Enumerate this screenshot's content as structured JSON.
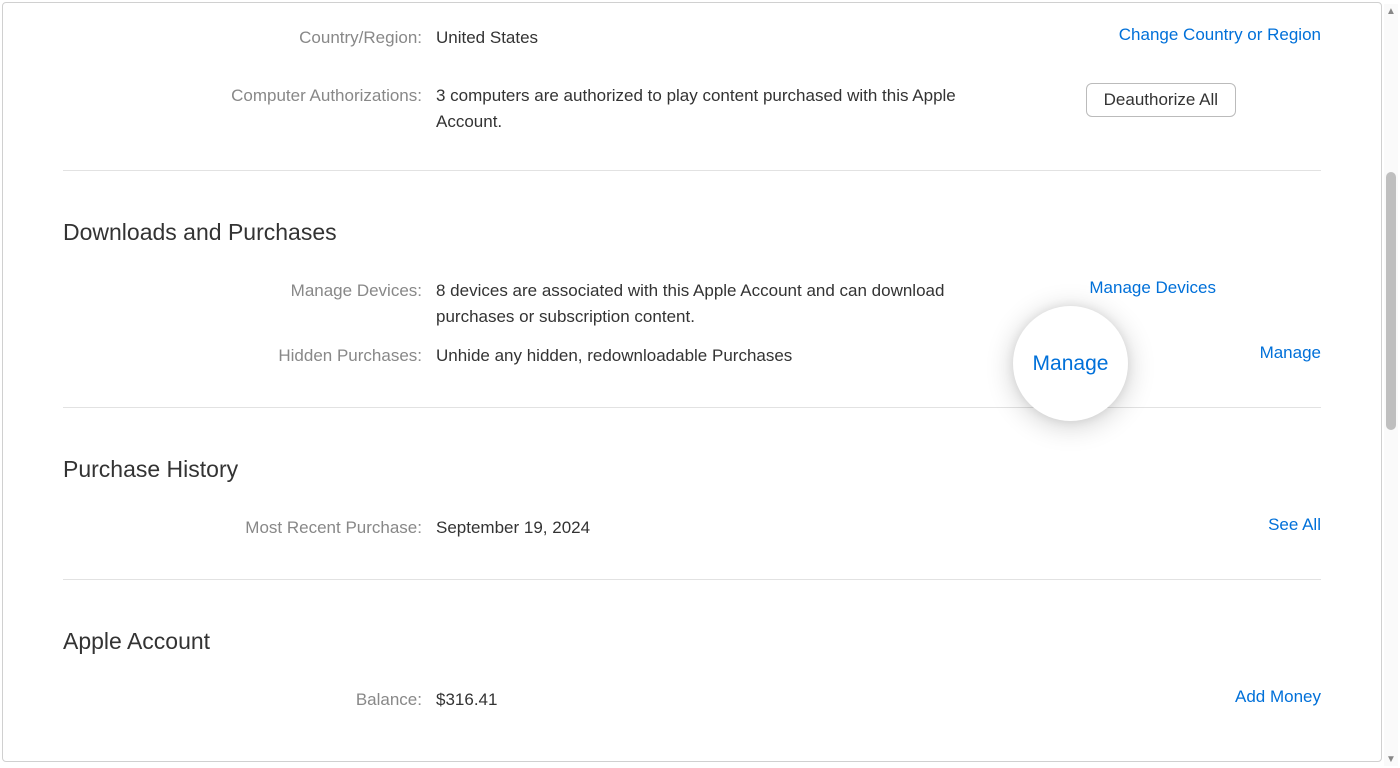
{
  "upperSection": {
    "countryRegion": {
      "label": "Country/Region:",
      "value": "United States",
      "action": "Change Country or Region"
    },
    "computerAuth": {
      "label": "Computer Authorizations:",
      "value": "3 computers are authorized to play content purchased with this Apple Account.",
      "action": "Deauthorize All"
    }
  },
  "downloads": {
    "title": "Downloads and Purchases",
    "manageDevices": {
      "label": "Manage Devices:",
      "value": "8 devices are associated with this Apple Account and can download purchases or subscription content.",
      "action": "Manage Devices"
    },
    "hiddenPurchases": {
      "label": "Hidden Purchases:",
      "value": "Unhide any hidden, redownloadable Purchases",
      "action": "Manage"
    }
  },
  "purchaseHistory": {
    "title": "Purchase History",
    "mostRecent": {
      "label": "Most Recent Purchase:",
      "value": "September 19, 2024",
      "action": "See All"
    }
  },
  "appleAccount": {
    "title": "Apple Account",
    "balance": {
      "label": "Balance:",
      "value": "$316.41",
      "action": "Add Money"
    }
  },
  "highlight": {
    "text": "Manage"
  }
}
